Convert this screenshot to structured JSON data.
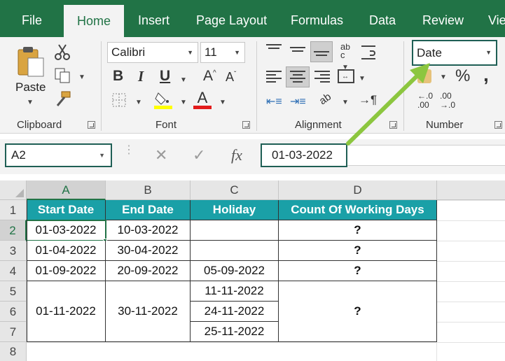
{
  "tabs": [
    "File",
    "Home",
    "Insert",
    "Page Layout",
    "Formulas",
    "Data",
    "Review",
    "View"
  ],
  "ribbon": {
    "paste_label": "Paste",
    "clipboard_label": "Clipboard",
    "font_name": "Calibri",
    "font_size": "11",
    "font_label": "Font",
    "alignment_label": "Alignment",
    "number_format": "Date",
    "number_label": "Number",
    "percent": "%",
    "comma": ",",
    "increase_decimal": ".00 →.0",
    "decrease_decimal": ".00"
  },
  "formula_bar": {
    "name_box": "A2",
    "fx": "fx",
    "formula": "01-03-2022"
  },
  "columns": [
    "A",
    "B",
    "C",
    "D"
  ],
  "rows": [
    "1",
    "2",
    "3",
    "4",
    "5",
    "6",
    "7",
    "8"
  ],
  "table": {
    "headers": [
      "Start Date",
      "End Date",
      "Holiday",
      "Count Of Working Days"
    ],
    "r2": [
      "01-03-2022",
      "10-03-2022",
      "",
      "?"
    ],
    "r3": [
      "01-04-2022",
      "30-04-2022",
      "",
      "?"
    ],
    "r4": [
      "01-09-2022",
      "20-09-2022",
      "05-09-2022",
      "?"
    ],
    "merged_start": "01-11-2022",
    "merged_end": "30-11-2022",
    "holidays_567": [
      "11-11-2022",
      "24-11-2022",
      "25-11-2022"
    ],
    "merged_count": "?"
  },
  "colors": {
    "excel_green": "#217346",
    "header_fill": "#1aa0a7",
    "callout_border": "#1f5f55",
    "arrow": "#8cc63f"
  }
}
